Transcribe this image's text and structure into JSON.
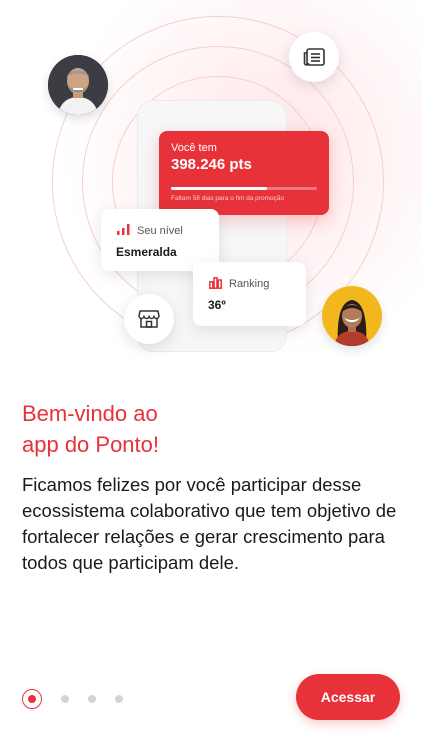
{
  "points_card": {
    "label": "Você tem",
    "value": "398.246 pts",
    "progress": 0.66,
    "note": "Faltam 58 dias para o fim da promoção"
  },
  "level_card": {
    "title": "Seu nível",
    "value": "Esmeralda"
  },
  "ranking_card": {
    "title": "Ranking",
    "value": "36º"
  },
  "intro": {
    "title_line1": "Bem-vindo ao",
    "title_line2": "app do Ponto!",
    "description": "Ficamos felizes por você participar desse ecossistema colaborativo que tem objetivo de fortalecer relações e gerar crescimento para todos que participam dele."
  },
  "pagination": {
    "current": 1,
    "total": 4
  },
  "cta": {
    "label": "Acessar"
  },
  "icons": {
    "news": "newspaper-icon",
    "store": "store-icon",
    "level": "signal-bars-icon",
    "ranking": "bar-chart-icon"
  },
  "colors": {
    "brand": "#e8323a",
    "background": "#ffffff",
    "text": "#1a1a1a",
    "ring": "#f4cfd2",
    "inactive_dot": "#d4d4d4"
  }
}
